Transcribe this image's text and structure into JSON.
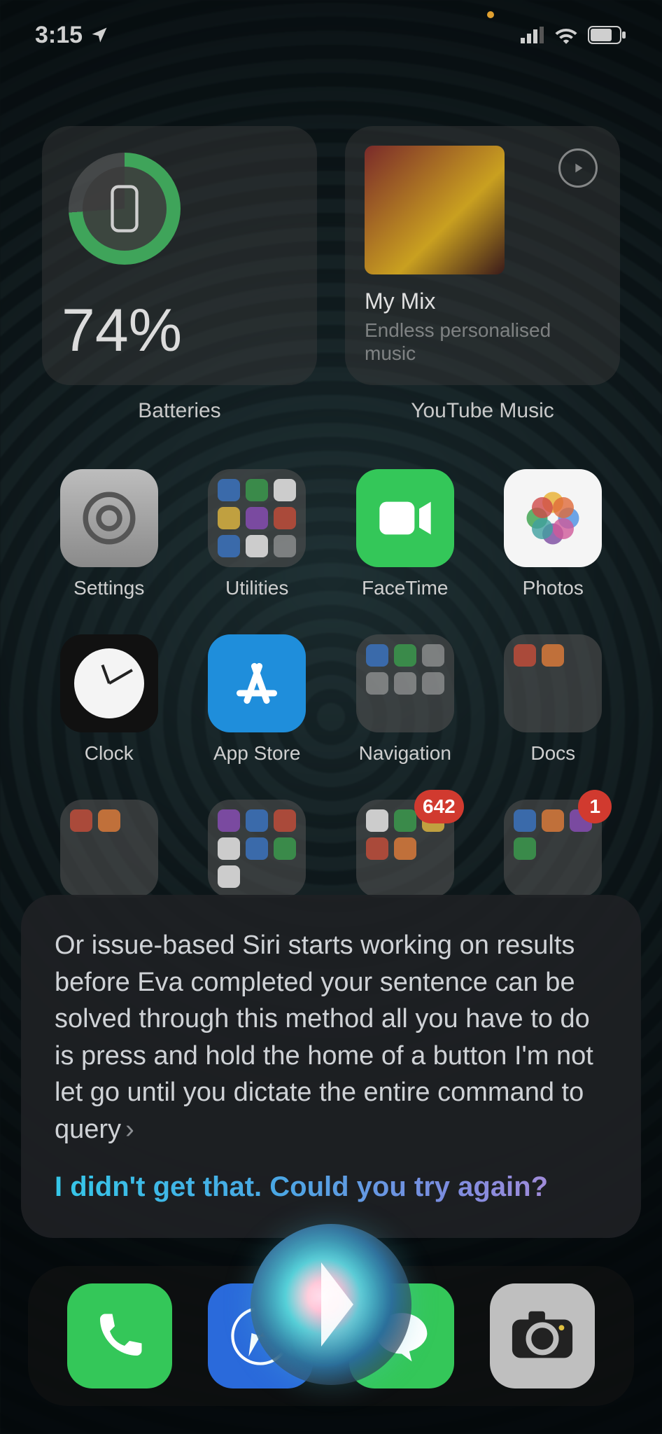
{
  "status": {
    "time": "3:15",
    "location_icon": "location-arrow",
    "cell_bars": 3,
    "wifi": true,
    "battery_level_pct": 70
  },
  "widgets": {
    "battery": {
      "label": "Batteries",
      "percent_text": "74%",
      "ring_fill_pct": 74,
      "device_icon": "iphone"
    },
    "music": {
      "label": "YouTube Music",
      "play_icon": "play-circle",
      "title": "My Mix",
      "subtitle": "Endless personalised music"
    }
  },
  "apps": {
    "row1": [
      {
        "name": "Settings",
        "icon": "gear"
      },
      {
        "name": "Utilities",
        "icon": "folder"
      },
      {
        "name": "FaceTime",
        "icon": "video"
      },
      {
        "name": "Photos",
        "icon": "flower"
      }
    ],
    "row2": [
      {
        "name": "Clock",
        "icon": "clock"
      },
      {
        "name": "App Store",
        "icon": "appstore"
      },
      {
        "name": "Navigation",
        "icon": "folder"
      },
      {
        "name": "Docs",
        "icon": "folder"
      }
    ],
    "row3": [
      {
        "name": "",
        "icon": "folder",
        "badge": null
      },
      {
        "name": "",
        "icon": "folder",
        "badge": null
      },
      {
        "name": "",
        "icon": "folder",
        "badge": "642"
      },
      {
        "name": "",
        "icon": "folder",
        "badge": "1"
      }
    ]
  },
  "siri": {
    "transcript": "Or issue-based Siri starts working on results before Eva completed your sentence can be solved through this method all you have to do is press and hold the home of a button I'm not let go until you dictate the entire command to query",
    "chevron": "›",
    "reply": "I didn't get that. Could you try again?"
  },
  "dock": [
    {
      "name": "Phone",
      "icon": "phone"
    },
    {
      "name": "Safari",
      "icon": "compass"
    },
    {
      "name": "Messages",
      "icon": "message"
    },
    {
      "name": "Camera",
      "icon": "camera"
    }
  ]
}
